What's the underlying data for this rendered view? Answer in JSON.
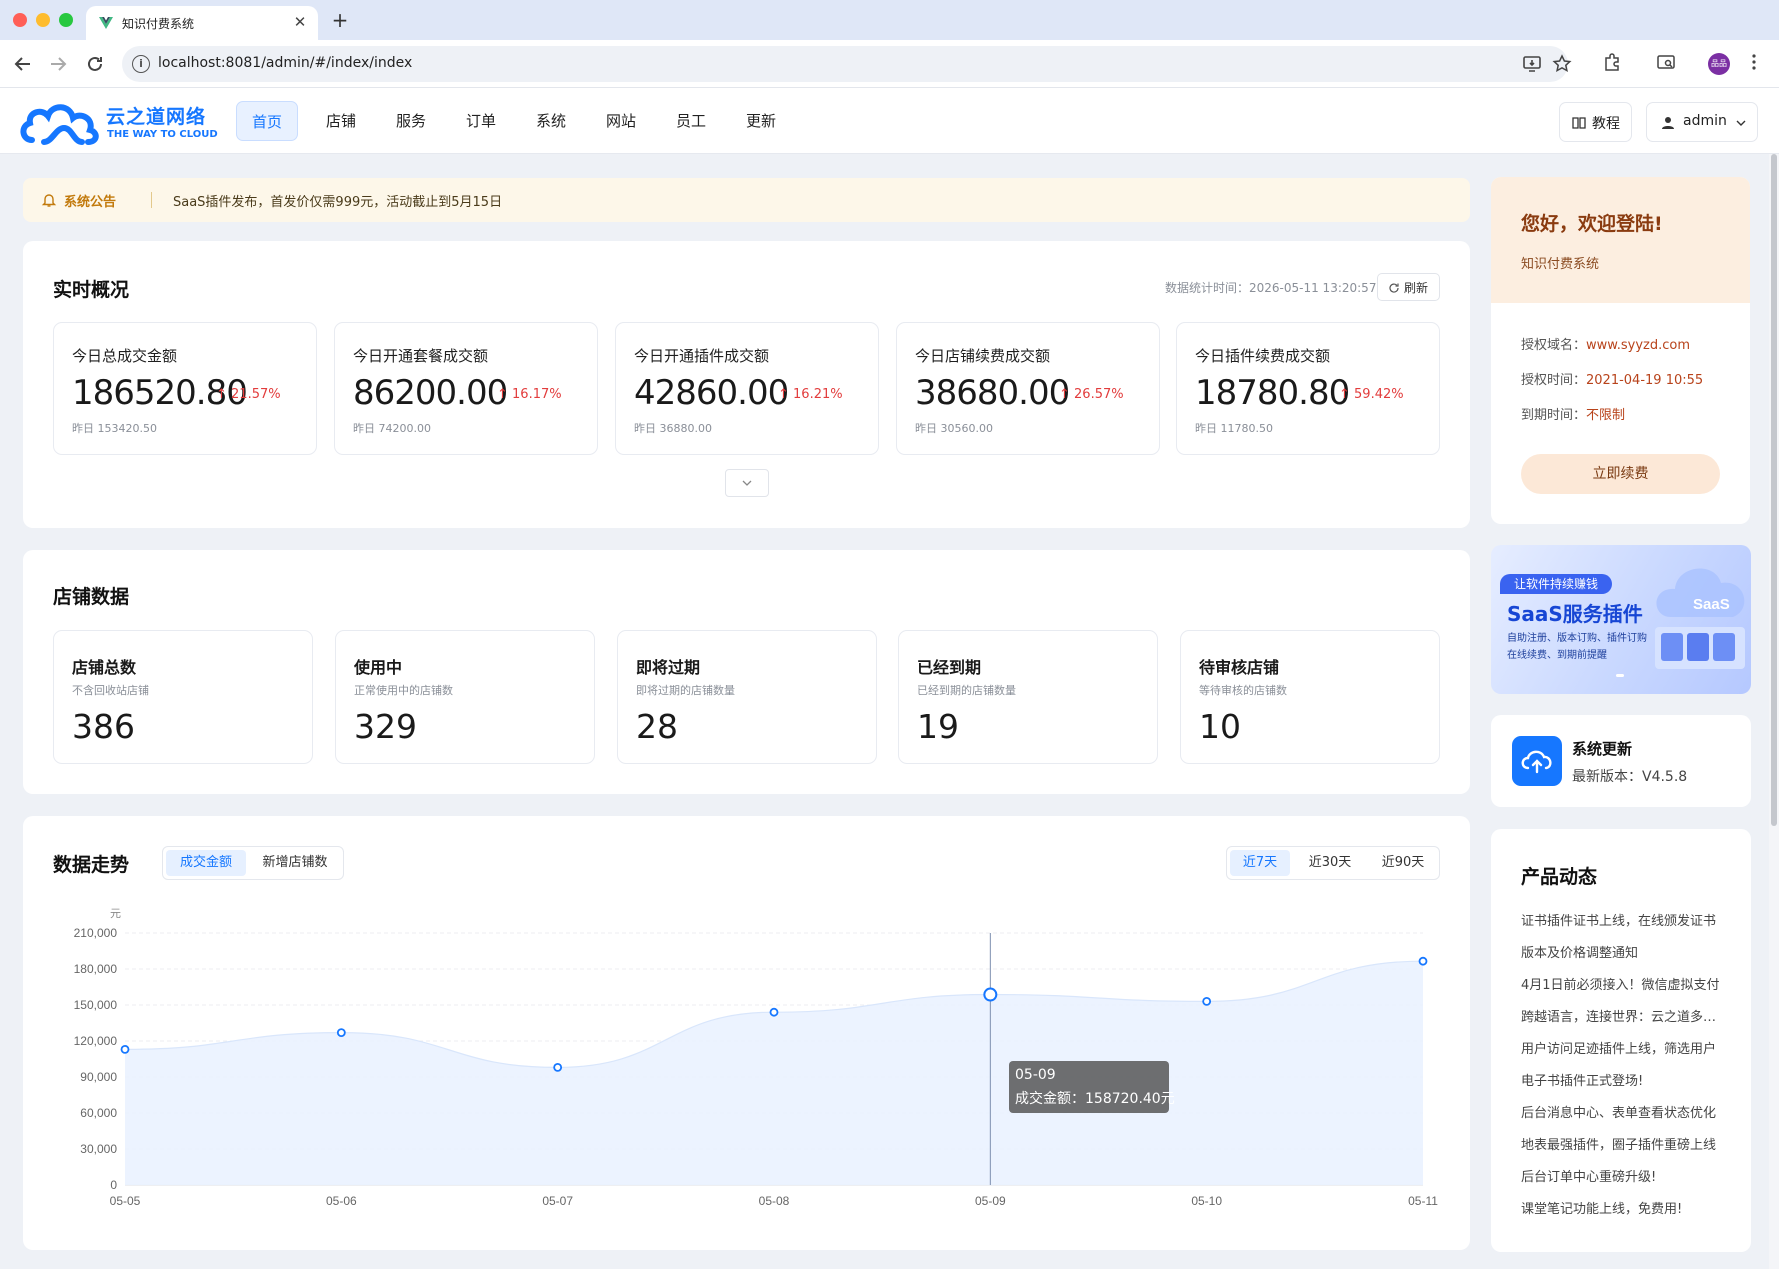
{
  "browser": {
    "tab_title": "知识付费系统",
    "tab_close": "✕",
    "new_tab": "+",
    "url": "localhost:8081/admin/#/index/index",
    "profile_initials": "品品"
  },
  "header": {
    "brand_cn": "云之道网络",
    "brand_en": "THE WAY TO CLOUD",
    "menu": [
      "首页",
      "店铺",
      "服务",
      "订单",
      "系统",
      "网站",
      "员工",
      "更新"
    ],
    "active_menu": "首页",
    "tutorial_label": "教程",
    "user_label": "admin"
  },
  "notice": {
    "title": "系统公告",
    "text": "SaaS插件发布，首发价仅需999元，活动截止到5月15日"
  },
  "realtime": {
    "title": "实时概况",
    "stat_time_label": "数据统计时间：2026-05-11 13:20:57",
    "refresh_label": "刷新",
    "cards": [
      {
        "label": "今日总成交金额",
        "value": "186520.80",
        "change": "21.57%",
        "yesterday": "昨日 153420.50"
      },
      {
        "label": "今日开通套餐成交额",
        "value": "86200.00",
        "change": "16.17%",
        "yesterday": "昨日 74200.00"
      },
      {
        "label": "今日开通插件成交额",
        "value": "42860.00",
        "change": "16.21%",
        "yesterday": "昨日 36880.00"
      },
      {
        "label": "今日店铺续费成交额",
        "value": "38680.00",
        "change": "26.57%",
        "yesterday": "昨日 30560.00"
      },
      {
        "label": "今日插件续费成交额",
        "value": "18780.80",
        "change": "59.42%",
        "yesterday": "昨日 11780.50"
      }
    ]
  },
  "shops": {
    "title": "店铺数据",
    "cards": [
      {
        "label": "店铺总数",
        "sub": "不含回收站店铺",
        "value": "386"
      },
      {
        "label": "使用中",
        "sub": "正常使用中的店铺数",
        "value": "329"
      },
      {
        "label": "即将过期",
        "sub": "即将过期的店铺数量",
        "value": "28"
      },
      {
        "label": "已经到期",
        "sub": "已经到期的店铺数量",
        "value": "19"
      },
      {
        "label": "待审核店铺",
        "sub": "等待审核的店铺数",
        "value": "10"
      }
    ]
  },
  "trend": {
    "title": "数据走势",
    "metric_tabs": [
      "成交金额",
      "新增店铺数"
    ],
    "active_metric": "成交金额",
    "range_tabs": [
      "近7天",
      "近30天",
      "近90天"
    ],
    "active_range": "近7天",
    "tooltip_date": "05-09",
    "tooltip_text": "成交金额：158720.40元"
  },
  "chart_data": {
    "type": "area",
    "x": [
      "05-05",
      "05-06",
      "05-07",
      "05-08",
      "05-09",
      "05-10",
      "05-11"
    ],
    "series": [
      {
        "name": "成交金额",
        "values": [
          113000,
          127000,
          98000,
          144000,
          158720.4,
          153000,
          186520.8
        ]
      }
    ],
    "ylabel": "元",
    "ylim": [
      0,
      210000
    ],
    "yticks": [
      "210,000",
      "180,000",
      "150,000",
      "120,000",
      "90,000",
      "60,000",
      "30,000",
      "0"
    ],
    "highlight_index": 4,
    "grid": true,
    "colors": {
      "line": "#1677ff",
      "area": "#eaf2ff"
    }
  },
  "sidebar": {
    "welcome_title": "您好，欢迎登陆!",
    "welcome_sub": "知识付费系统",
    "auth_domain_label": "授权域名：",
    "auth_domain": "www.syyzd.com",
    "auth_time_label": "授权时间：",
    "auth_time": "2021-04-19 10:55",
    "expire_label": "到期时间：",
    "expire": "不限制",
    "renew_label": "立即续费",
    "banner_tag": "让软件持续赚钱",
    "banner_title": "SaaS服务插件",
    "banner_line1": "自助注册、版本订购、插件订购",
    "banner_line2": "在线续费、到期前提醒",
    "banner_cloud": "SaaS",
    "update_title": "系统更新",
    "update_version": "最新版本：V4.5.8",
    "news_title": "产品动态",
    "news": [
      "证书插件证书上线，在线颁发证书",
      "版本及价格调整通知",
      "4月1日前必须接入！微信虚拟支付",
      "跨越语言，连接世界：云之道多语言",
      "用户访问足迹插件上线，筛选用户",
      "电子书插件正式登场!",
      "后台消息中心、表单查看状态优化",
      "地表最强插件，圈子插件重磅上线",
      "后台订单中心重磅升级!",
      "课堂笔记功能上线，免费用!"
    ]
  },
  "icons": {
    "back": "arrow-left-icon",
    "forward": "arrow-right-icon",
    "reload": "reload-icon",
    "bell": "bell-icon",
    "book": "book-icon",
    "user": "user-icon",
    "chevron": "chevron-down-icon",
    "upload": "cloud-upload-icon"
  }
}
